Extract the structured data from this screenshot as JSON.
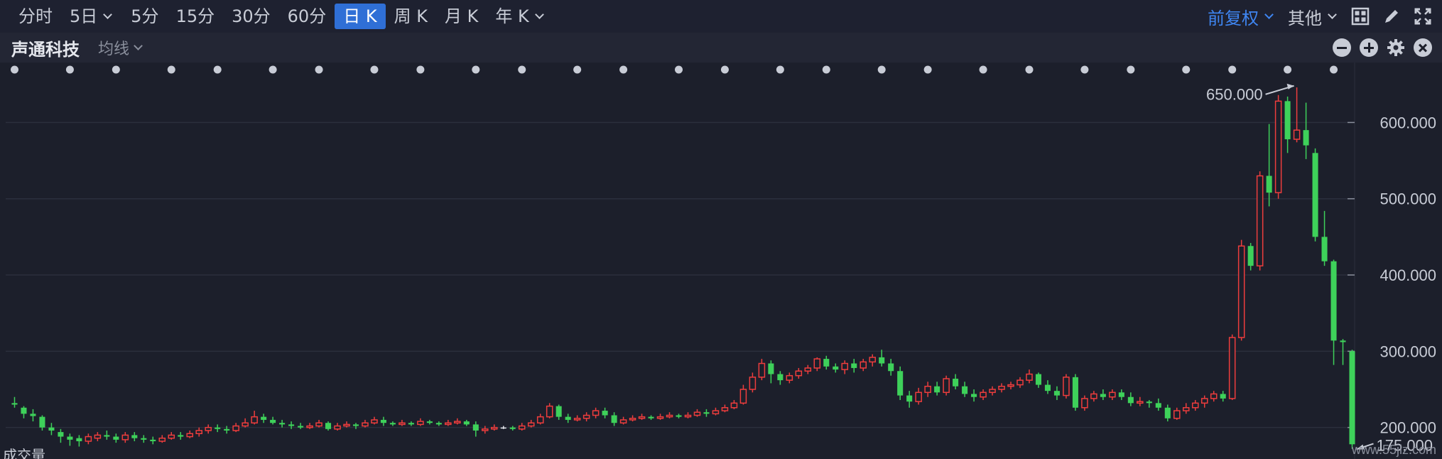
{
  "toolbar": {
    "tabs": [
      {
        "label": "分时",
        "active": false,
        "dropdown": false
      },
      {
        "label": "5日",
        "active": false,
        "dropdown": true
      },
      {
        "label": "5分",
        "active": false,
        "dropdown": false
      },
      {
        "label": "15分",
        "active": false,
        "dropdown": false
      },
      {
        "label": "30分",
        "active": false,
        "dropdown": false
      },
      {
        "label": "60分",
        "active": false,
        "dropdown": false
      },
      {
        "label": "日 K",
        "active": true,
        "dropdown": false
      },
      {
        "label": "周 K",
        "active": false,
        "dropdown": false
      },
      {
        "label": "月 K",
        "active": false,
        "dropdown": false
      },
      {
        "label": "年 K",
        "active": false,
        "dropdown": true
      }
    ],
    "adjust_label": "前复权",
    "other_label": "其他",
    "icons": [
      "grid-icon",
      "draw-pen-icon",
      "fullscreen-icon"
    ]
  },
  "subbar": {
    "stock_name": "声通科技",
    "ma_label": "均线",
    "icons": [
      "zoom-out-icon",
      "zoom-in-icon",
      "settings-icon",
      "close-icon"
    ]
  },
  "colors": {
    "up": "#ee3d3d",
    "down": "#3ed15a",
    "flat": "#e6e8ee",
    "accent": "#2f6fd6",
    "grid": "#2b2f3d"
  },
  "chart_data": {
    "type": "candlestick",
    "y_ticks": [
      "200.000",
      "300.000",
      "400.000",
      "500.000",
      "600.000"
    ],
    "y_tick_values": [
      200,
      300,
      400,
      500,
      600
    ],
    "ylim": [
      168,
      660
    ],
    "max_label": "650.000",
    "min_label": "175.000",
    "max_value": 650,
    "min_value": 175,
    "candles": [
      [
        232,
        230,
        240,
        226
      ],
      [
        226,
        218,
        228,
        212
      ],
      [
        218,
        215,
        224,
        208
      ],
      [
        214,
        200,
        216,
        196
      ],
      [
        200,
        196,
        206,
        190
      ],
      [
        194,
        188,
        198,
        180
      ],
      [
        188,
        184,
        192,
        176
      ],
      [
        186,
        182,
        190,
        175
      ],
      [
        182,
        188,
        192,
        178
      ],
      [
        186,
        190,
        194,
        182
      ],
      [
        190,
        188,
        196,
        184
      ],
      [
        188,
        184,
        192,
        180
      ],
      [
        184,
        190,
        194,
        180
      ],
      [
        190,
        186,
        194,
        182
      ],
      [
        186,
        184,
        190,
        180
      ],
      [
        184,
        182,
        188,
        178
      ],
      [
        182,
        186,
        190,
        180
      ],
      [
        186,
        190,
        194,
        184
      ],
      [
        190,
        188,
        194,
        184
      ],
      [
        188,
        192,
        196,
        186
      ],
      [
        192,
        196,
        200,
        188
      ],
      [
        196,
        200,
        204,
        192
      ],
      [
        200,
        198,
        204,
        194
      ],
      [
        198,
        196,
        202,
        192
      ],
      [
        196,
        202,
        206,
        194
      ],
      [
        202,
        206,
        212,
        200
      ],
      [
        206,
        214,
        222,
        204
      ],
      [
        214,
        210,
        218,
        206
      ],
      [
        210,
        206,
        214,
        204
      ],
      [
        206,
        204,
        210,
        200
      ],
      [
        204,
        202,
        208,
        198
      ],
      [
        202,
        200,
        206,
        198
      ],
      [
        200,
        202,
        206,
        198
      ],
      [
        202,
        206,
        210,
        200
      ],
      [
        206,
        198,
        208,
        196
      ],
      [
        198,
        202,
        206,
        196
      ],
      [
        202,
        204,
        208,
        200
      ],
      [
        204,
        202,
        206,
        198
      ],
      [
        202,
        206,
        210,
        200
      ],
      [
        206,
        210,
        214,
        204
      ],
      [
        210,
        206,
        214,
        202
      ],
      [
        206,
        204,
        208,
        202
      ],
      [
        204,
        206,
        210,
        202
      ],
      [
        206,
        204,
        208,
        202
      ],
      [
        204,
        208,
        212,
        202
      ],
      [
        208,
        206,
        210,
        204
      ],
      [
        206,
        204,
        208,
        202
      ],
      [
        204,
        206,
        210,
        202
      ],
      [
        206,
        208,
        212,
        204
      ],
      [
        208,
        204,
        210,
        202
      ],
      [
        204,
        196,
        208,
        188
      ],
      [
        196,
        198,
        202,
        192
      ],
      [
        198,
        200,
        204,
        196
      ],
      [
        200,
        200,
        202,
        198
      ],
      [
        200,
        198,
        202,
        196
      ],
      [
        198,
        202,
        206,
        196
      ],
      [
        202,
        206,
        210,
        200
      ],
      [
        206,
        214,
        218,
        204
      ],
      [
        214,
        228,
        232,
        212
      ],
      [
        228,
        214,
        230,
        210
      ],
      [
        214,
        210,
        218,
        206
      ],
      [
        210,
        212,
        216,
        208
      ],
      [
        212,
        216,
        220,
        208
      ],
      [
        216,
        222,
        226,
        212
      ],
      [
        222,
        216,
        226,
        212
      ],
      [
        216,
        206,
        220,
        202
      ],
      [
        206,
        210,
        214,
        204
      ],
      [
        210,
        212,
        216,
        208
      ],
      [
        212,
        214,
        218,
        210
      ],
      [
        214,
        212,
        216,
        210
      ],
      [
        212,
        214,
        218,
        210
      ],
      [
        214,
        216,
        220,
        212
      ],
      [
        216,
        214,
        218,
        212
      ],
      [
        214,
        216,
        220,
        212
      ],
      [
        216,
        220,
        224,
        214
      ],
      [
        220,
        218,
        224,
        214
      ],
      [
        218,
        222,
        226,
        216
      ],
      [
        222,
        226,
        230,
        220
      ],
      [
        226,
        232,
        236,
        224
      ],
      [
        232,
        250,
        256,
        230
      ],
      [
        250,
        266,
        272,
        246
      ],
      [
        266,
        284,
        290,
        262
      ],
      [
        284,
        270,
        288,
        258
      ],
      [
        270,
        262,
        274,
        256
      ],
      [
        262,
        268,
        272,
        258
      ],
      [
        268,
        274,
        278,
        264
      ],
      [
        274,
        278,
        282,
        270
      ],
      [
        278,
        290,
        292,
        274
      ],
      [
        290,
        280,
        294,
        276
      ],
      [
        280,
        276,
        284,
        272
      ],
      [
        276,
        284,
        288,
        270
      ],
      [
        284,
        278,
        290,
        272
      ],
      [
        278,
        286,
        290,
        274
      ],
      [
        286,
        292,
        296,
        280
      ],
      [
        292,
        284,
        302,
        280
      ],
      [
        284,
        274,
        290,
        268
      ],
      [
        274,
        242,
        280,
        236
      ],
      [
        242,
        234,
        248,
        226
      ],
      [
        234,
        246,
        252,
        230
      ],
      [
        246,
        254,
        260,
        240
      ],
      [
        254,
        246,
        260,
        242
      ],
      [
        246,
        264,
        268,
        242
      ],
      [
        264,
        254,
        270,
        250
      ],
      [
        254,
        244,
        260,
        240
      ],
      [
        244,
        240,
        250,
        234
      ],
      [
        240,
        246,
        250,
        236
      ],
      [
        246,
        250,
        254,
        242
      ],
      [
        250,
        254,
        258,
        246
      ],
      [
        254,
        256,
        260,
        250
      ],
      [
        256,
        262,
        266,
        252
      ],
      [
        262,
        270,
        276,
        258
      ],
      [
        270,
        256,
        272,
        252
      ],
      [
        256,
        248,
        262,
        244
      ],
      [
        248,
        242,
        254,
        236
      ],
      [
        242,
        266,
        270,
        238
      ],
      [
        266,
        226,
        270,
        222
      ],
      [
        226,
        238,
        242,
        222
      ],
      [
        238,
        244,
        248,
        234
      ],
      [
        244,
        240,
        250,
        236
      ],
      [
        240,
        246,
        250,
        236
      ],
      [
        246,
        240,
        250,
        236
      ],
      [
        240,
        232,
        246,
        228
      ],
      [
        232,
        234,
        240,
        228
      ],
      [
        234,
        232,
        236,
        226
      ],
      [
        232,
        226,
        238,
        222
      ],
      [
        226,
        212,
        230,
        208
      ],
      [
        212,
        222,
        226,
        210
      ],
      [
        222,
        226,
        232,
        218
      ],
      [
        226,
        232,
        236,
        222
      ],
      [
        232,
        238,
        242,
        226
      ],
      [
        238,
        244,
        248,
        234
      ],
      [
        244,
        238,
        248,
        234
      ],
      [
        238,
        318,
        322,
        236
      ],
      [
        318,
        438,
        446,
        314
      ],
      [
        438,
        412,
        442,
        406
      ],
      [
        412,
        530,
        536,
        406
      ],
      [
        530,
        508,
        598,
        490
      ],
      [
        508,
        628,
        636,
        500
      ],
      [
        628,
        578,
        634,
        560
      ],
      [
        578,
        590,
        646,
        574
      ],
      [
        590,
        570,
        626,
        552
      ],
      [
        560,
        450,
        566,
        444
      ],
      [
        450,
        418,
        484,
        412
      ],
      [
        418,
        314,
        420,
        282
      ],
      [
        314,
        312,
        316,
        282
      ],
      [
        300,
        178,
        302,
        172
      ]
    ],
    "event_markers": 27
  },
  "watermark": "www.55jlz.com",
  "bottom_label": "成交量"
}
